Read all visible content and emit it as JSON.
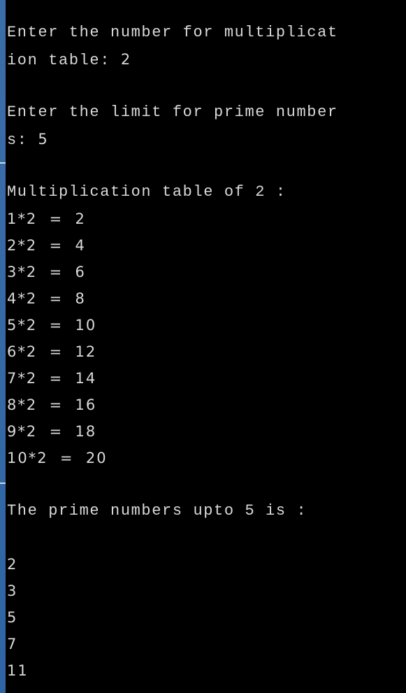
{
  "prompt_mult": {
    "label_line1": "Enter the number for multiplicat",
    "label_line2": "ion table: ",
    "value": "2"
  },
  "prompt_prime": {
    "label_line1": "Enter the limit for prime number",
    "label_line2": "s: ",
    "value": "5"
  },
  "table": {
    "heading": "Multiplication table of 2 :",
    "rows": [
      "1*2  =  2",
      "2*2  =  4",
      "3*2  =  6",
      "4*2  =  8",
      "5*2  =  10",
      "6*2  =  12",
      "7*2  =  14",
      "8*2  =  16",
      "9*2  =  18",
      "10*2  =  20"
    ]
  },
  "primes": {
    "heading": "The prime numbers upto 5 is :",
    "values": [
      "2",
      "3",
      "5",
      "7",
      "11"
    ]
  },
  "colors": {
    "background": "#000000",
    "text": "#d9d9d9",
    "accent_bar": "#2f64a6"
  }
}
